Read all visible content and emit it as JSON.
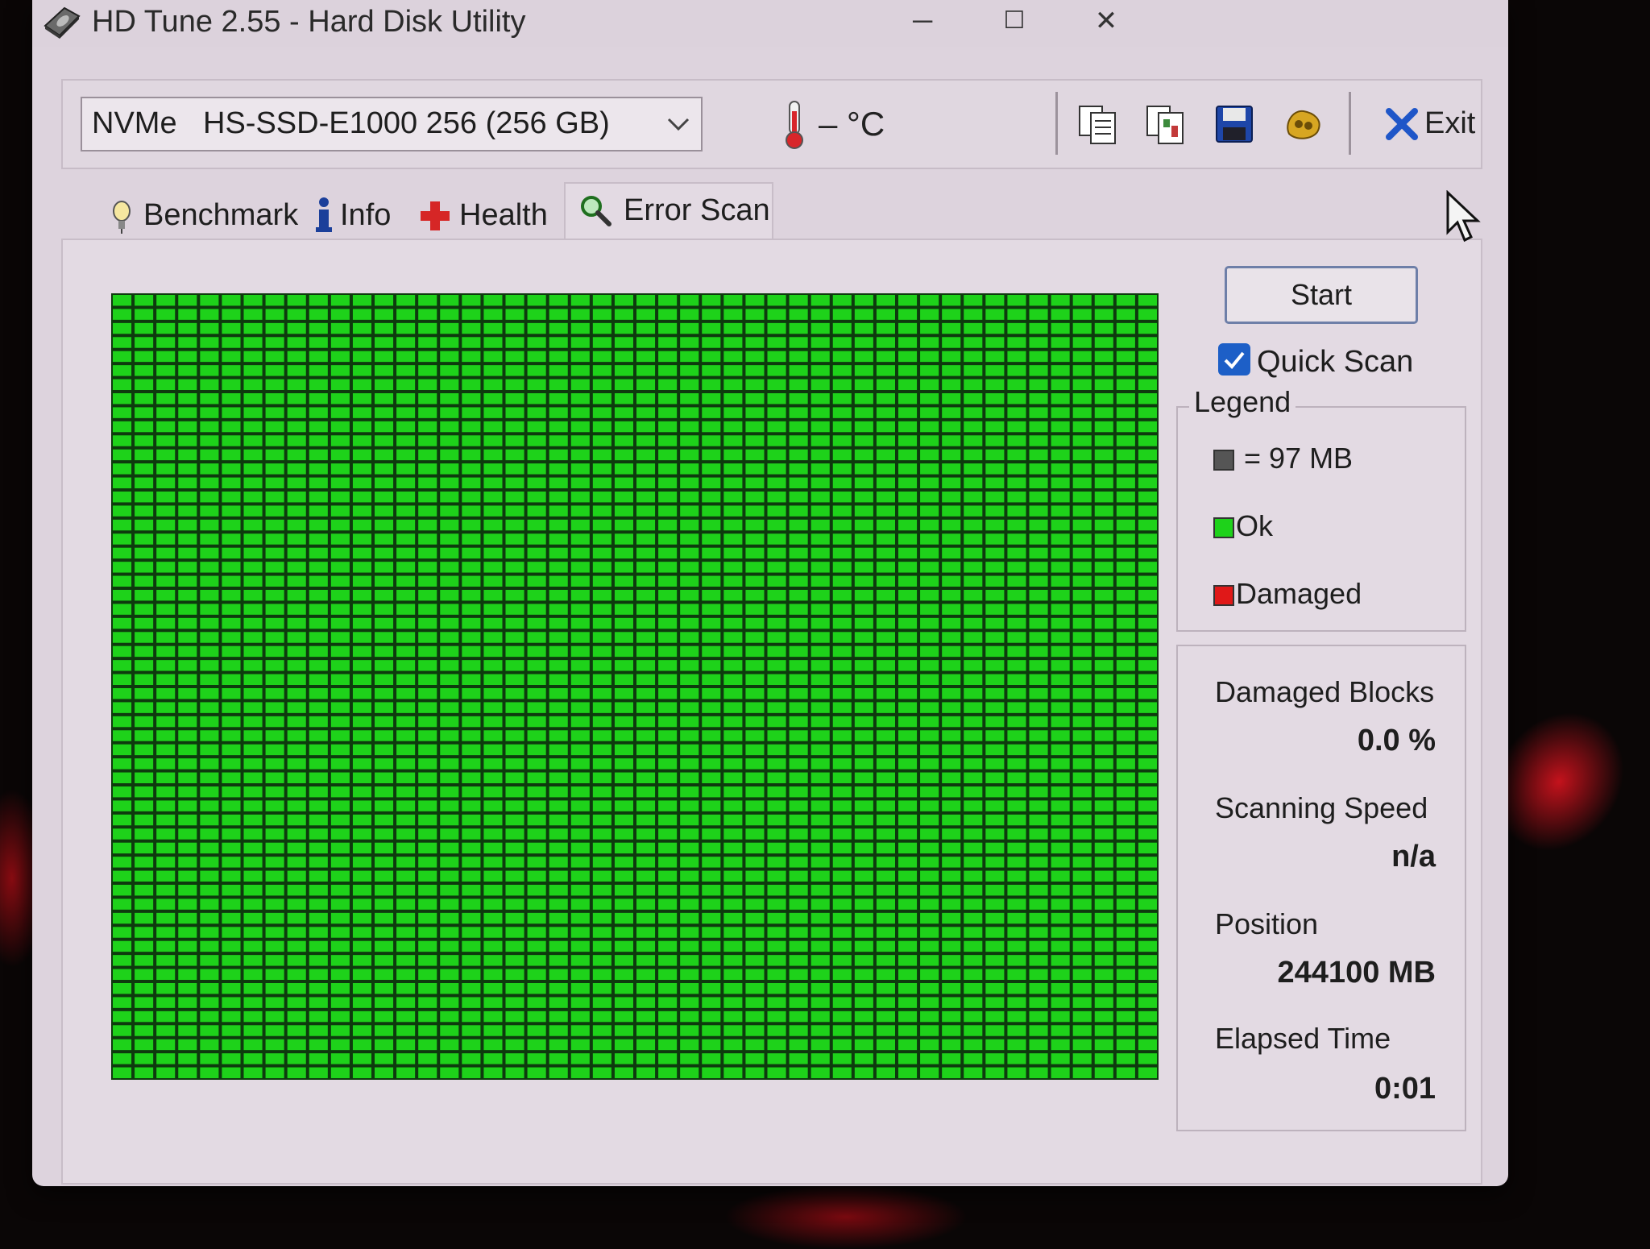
{
  "window": {
    "title": "HD Tune 2.55 - Hard Disk Utility",
    "controls": {
      "minimize": "─",
      "maximize": "☐",
      "close": "✕"
    }
  },
  "toolbar": {
    "drive_type": "NVMe",
    "drive_name": "HS-SSD-E1000 256 (256 GB)",
    "temperature": "– °C",
    "buttons": [
      "copy-text-icon",
      "copy-info-icon",
      "save-icon",
      "options-icon"
    ],
    "exit_label": "Exit"
  },
  "tabs": [
    {
      "label": "Benchmark",
      "icon": "benchmark-icon"
    },
    {
      "label": "Info",
      "icon": "info-icon"
    },
    {
      "label": "Health",
      "icon": "health-icon"
    },
    {
      "label": "Error Scan",
      "icon": "magnifier-icon",
      "active": true
    }
  ],
  "error_scan": {
    "start_label": "Start",
    "quick_scan_label": "Quick Scan",
    "quick_scan_checked": true,
    "block_colors": {
      "ok": "#1ed21a",
      "damaged": "#e01818",
      "border": "#0e3a0e"
    },
    "legend": {
      "title": "Legend",
      "block_size": "= 97 MB",
      "ok_label": "Ok",
      "damaged_label": "Damaged"
    },
    "stats": {
      "damaged_blocks_label": "Damaged Blocks",
      "damaged_blocks_value": "0.0 %",
      "scanning_speed_label": "Scanning Speed",
      "scanning_speed_value": "n/a",
      "position_label": "Position",
      "position_value": "244100 MB",
      "elapsed_label": "Elapsed Time",
      "elapsed_value": "0:01"
    }
  }
}
